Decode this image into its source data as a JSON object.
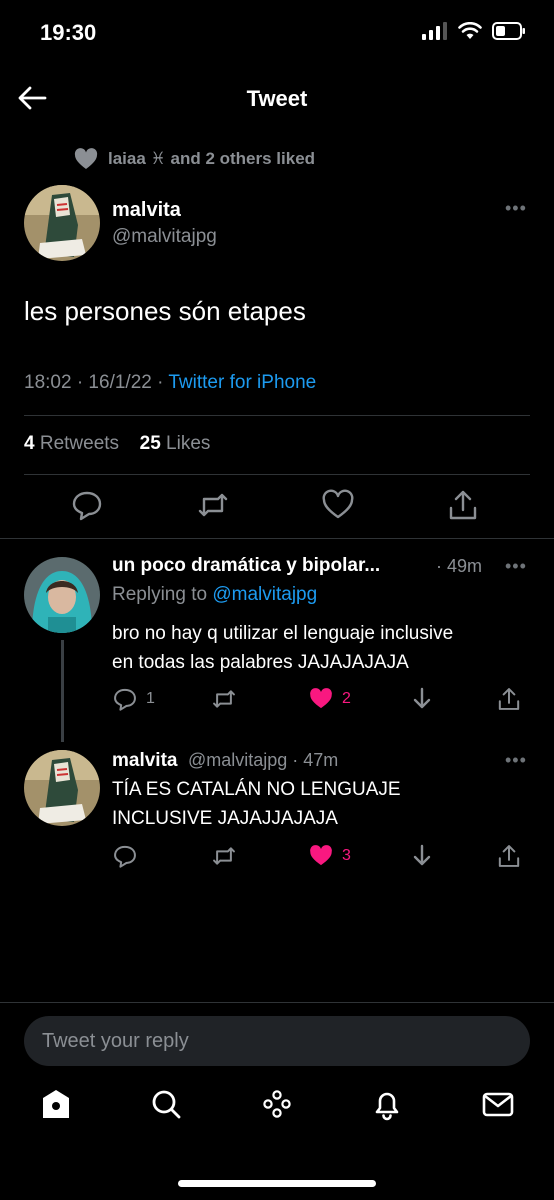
{
  "status_bar": {
    "time": "19:30"
  },
  "nav": {
    "title": "Tweet"
  },
  "social_context": {
    "liked_text": "laiaa ♓︎ and 2 others liked"
  },
  "tweet": {
    "author_name": "malvita",
    "author_handle": "@malvitajpg",
    "text": "les persones són etapes",
    "time": "18:02 · 16/1/22 · ",
    "source": "Twitter for iPhone",
    "retweets_count": "4",
    "retweets_label": " Retweets",
    "likes_count": "25",
    "likes_label": " Likes"
  },
  "replies": [
    {
      "name": "un poco dramática y bipolar...",
      "time": "· 49m",
      "replying_label": "Replying to ",
      "replying_handle": "@malvitajpg",
      "text_line1": "bro no hay q utilizar el lenguaje inclusive",
      "text_line2": "en todas las palabres JAJAJAJAJA",
      "reply_count": "1",
      "like_count": "2"
    },
    {
      "name": "malvita",
      "handle_time": "@malvitajpg · 47m",
      "text_line1": "TÍA ES CATALÁN NO LENGUAJE",
      "text_line2": "INCLUSIVE JAJAJJAJAJA",
      "like_count": "3"
    }
  ],
  "compose": {
    "placeholder": "Tweet your reply"
  },
  "colors": {
    "accent": "#1d9bf0",
    "like": "#f91880",
    "muted": "#8b8f94",
    "background": "#000000"
  },
  "icons": [
    "back-arrow-icon",
    "heart-icon",
    "more-icon",
    "reply-icon",
    "retweet-icon",
    "share-icon",
    "home-icon",
    "search-icon",
    "spaces-icon",
    "notifications-icon",
    "messages-icon"
  ]
}
